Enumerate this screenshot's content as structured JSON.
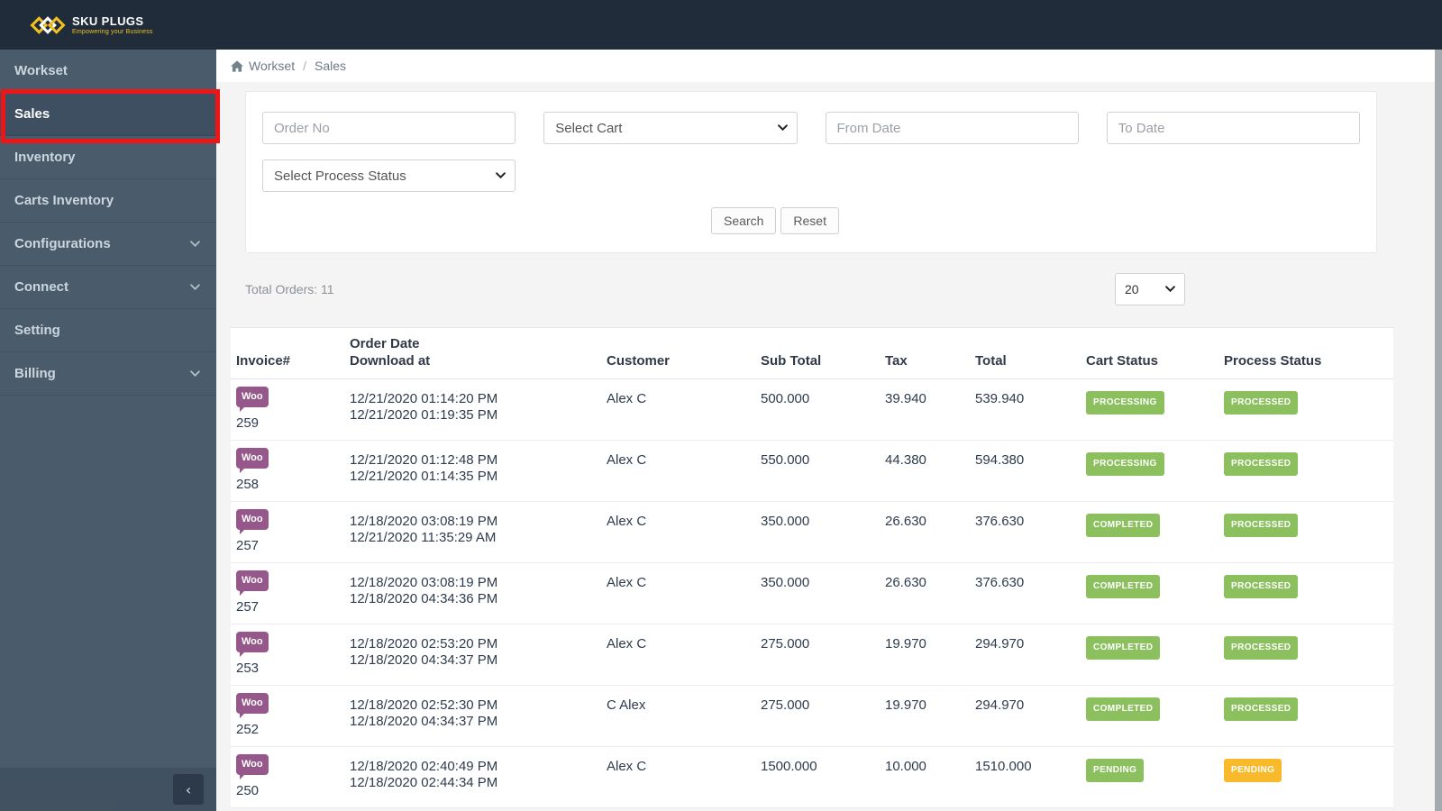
{
  "brand": {
    "name": "SKU PLUGS",
    "tagline": "Empowering your Business",
    "logo_icon": "diamonds-logo",
    "brand_yellow": "#f2c121"
  },
  "sidebar": {
    "items": [
      {
        "label": "Workset",
        "active": false,
        "has_chevron": false
      },
      {
        "label": "Sales",
        "active": true,
        "has_chevron": false
      },
      {
        "label": "Inventory",
        "active": false,
        "has_chevron": false
      },
      {
        "label": "Carts Inventory",
        "active": false,
        "has_chevron": false
      },
      {
        "label": "Configurations",
        "active": false,
        "has_chevron": true
      },
      {
        "label": "Connect",
        "active": false,
        "has_chevron": true
      },
      {
        "label": "Setting",
        "active": false,
        "has_chevron": false
      },
      {
        "label": "Billing",
        "active": false,
        "has_chevron": true
      }
    ],
    "collapse_icon": "chevron-left",
    "collapse_glyph": "‹"
  },
  "breadcrumb": {
    "section": "Workset",
    "separator": "/",
    "current": "Sales"
  },
  "filters": {
    "order_no": {
      "placeholder": "Order No",
      "value": ""
    },
    "cart_select": {
      "selected": "Select Cart"
    },
    "from_date": {
      "placeholder": "From Date",
      "value": ""
    },
    "to_date": {
      "placeholder": "To Date",
      "value": ""
    },
    "process_status_select": {
      "selected": "Select Process Status"
    },
    "search_button": "Search",
    "reset_button": "Reset"
  },
  "summary": {
    "total_orders": "Total Orders: 11",
    "page_size_selected": "20"
  },
  "table": {
    "headers": {
      "invoice": "Invoice#",
      "order_date_line1": "Order Date",
      "order_date_line2": "Download at",
      "customer": "Customer",
      "sub_total": "Sub Total",
      "tax": "Tax",
      "total": "Total",
      "cart_status": "Cart Status",
      "process_status": "Process Status"
    },
    "rows": [
      {
        "platform": "Woo",
        "invoice": "259",
        "order_date": "12/21/2020 01:14:20 PM",
        "download_at": "12/21/2020 01:19:35 PM",
        "customer": "Alex C",
        "sub_total": "500.000",
        "tax": "39.940",
        "total": "539.940",
        "cart_status": "PROCESSING",
        "cart_status_color": "green",
        "process_status": "PROCESSED",
        "process_status_color": "green"
      },
      {
        "platform": "Woo",
        "invoice": "258",
        "order_date": "12/21/2020 01:12:48 PM",
        "download_at": "12/21/2020 01:14:35 PM",
        "customer": "Alex C",
        "sub_total": "550.000",
        "tax": "44.380",
        "total": "594.380",
        "cart_status": "PROCESSING",
        "cart_status_color": "green",
        "process_status": "PROCESSED",
        "process_status_color": "green"
      },
      {
        "platform": "Woo",
        "invoice": "257",
        "order_date": "12/18/2020 03:08:19 PM",
        "download_at": "12/21/2020 11:35:29 AM",
        "customer": "Alex C",
        "sub_total": "350.000",
        "tax": "26.630",
        "total": "376.630",
        "cart_status": "COMPLETED",
        "cart_status_color": "green",
        "process_status": "PROCESSED",
        "process_status_color": "green"
      },
      {
        "platform": "Woo",
        "invoice": "257",
        "order_date": "12/18/2020 03:08:19 PM",
        "download_at": "12/18/2020 04:34:36 PM",
        "customer": "Alex C",
        "sub_total": "350.000",
        "tax": "26.630",
        "total": "376.630",
        "cart_status": "COMPLETED",
        "cart_status_color": "green",
        "process_status": "PROCESSED",
        "process_status_color": "green"
      },
      {
        "platform": "Woo",
        "invoice": "253",
        "order_date": "12/18/2020 02:53:20 PM",
        "download_at": "12/18/2020 04:34:37 PM",
        "customer": "Alex C",
        "sub_total": "275.000",
        "tax": "19.970",
        "total": "294.970",
        "cart_status": "COMPLETED",
        "cart_status_color": "green",
        "process_status": "PROCESSED",
        "process_status_color": "green"
      },
      {
        "platform": "Woo",
        "invoice": "252",
        "order_date": "12/18/2020 02:52:30 PM",
        "download_at": "12/18/2020 04:34:37 PM",
        "customer": "C Alex",
        "sub_total": "275.000",
        "tax": "19.970",
        "total": "294.970",
        "cart_status": "COMPLETED",
        "cart_status_color": "green",
        "process_status": "PROCESSED",
        "process_status_color": "green"
      },
      {
        "platform": "Woo",
        "invoice": "250",
        "order_date": "12/18/2020 02:40:49 PM",
        "download_at": "12/18/2020 02:44:34 PM",
        "customer": "Alex C",
        "sub_total": "1500.000",
        "tax": "10.000",
        "total": "1510.000",
        "cart_status": "PENDING",
        "cart_status_color": "green",
        "process_status": "PENDING",
        "process_status_color": "yellow"
      }
    ]
  },
  "colors": {
    "badge_green": "#8cc05f",
    "badge_yellow": "#f8ba2b",
    "woo_purple": "#96588a",
    "annotation_red": "#ed1515",
    "topbar": "#202c39",
    "sidebar": "#4a5b6c",
    "sidebar_active": "#3d4f60"
  }
}
